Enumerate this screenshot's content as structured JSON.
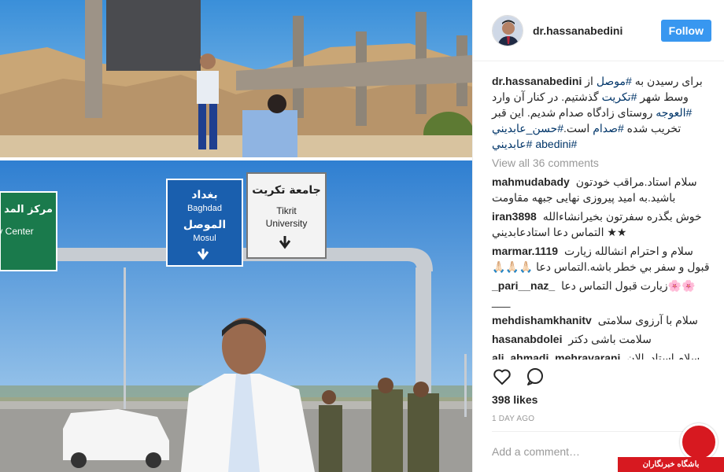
{
  "post": {
    "username": "dr.hassanabedini",
    "follow_label": "Follow",
    "caption": {
      "username": "dr.hassanabedini",
      "segments": [
        {
          "text": "برای رسیدن به ",
          "tag": false
        },
        {
          "text": "#موصل",
          "tag": true
        },
        {
          "text": " از وسط شهر ",
          "tag": false
        },
        {
          "text": "#تکریت",
          "tag": true
        },
        {
          "text": " گذشتیم. در کنار آن وارد ",
          "tag": false
        },
        {
          "text": "#العوجه",
          "tag": true
        },
        {
          "text": " روستای زادگاه صدام شدیم. این قبر تخریب شده ",
          "tag": false
        },
        {
          "text": "#صدام",
          "tag": true
        },
        {
          "text": " است.",
          "tag": false
        },
        {
          "text": "#حسن_عابديني",
          "tag": true
        },
        {
          "text": " ",
          "tag": false
        },
        {
          "text": "#abedini",
          "tag": true
        },
        {
          "text": " ",
          "tag": false
        },
        {
          "text": "#عابديني",
          "tag": true
        }
      ]
    },
    "view_all": "View all 36 comments",
    "comments": [
      {
        "user": "mahmudabady",
        "text": "سلام استاد.مراقب خودتون باشید.به امید پیروزی نهایی جبهه مقاومت"
      },
      {
        "user": "iran3898",
        "text": "خوش بگذره سفرتون بخيرانشاءالله ★★ التماس دعا استادعابديني"
      },
      {
        "user": "marmar.1119",
        "text": "سلام و احترام انشالله زیارت قبول و سفر بي خطر باشه.التماس دعا 🙏🏻🙏🏻🙏🏻"
      },
      {
        "user": "_pari__naz_",
        "text": "🌸🌸زيارت قبول التماس دعا ___"
      },
      {
        "user": "mehdishamkhanitv",
        "text": "سلام با آرزوی سلامتی"
      },
      {
        "user": "hasanabdolei",
        "text": "سلامت باشی دکتر"
      },
      {
        "user": "ali_ahmadi_mehravarani",
        "text": "سلام.استاد. الان کنار قبر تخریب شده هستید یا جاده؟😊!"
      }
    ],
    "likes": "398 likes",
    "time": "1 DAY AGO",
    "add_comment_placeholder": "Add a comment…"
  },
  "photo": {
    "sign_left_arabic": "بغداد",
    "sign_left_latin": "Baghdad",
    "sign_left_arabic2": "الموصل",
    "sign_left_latin2": "Mosul",
    "sign_right_arabic": "جامعة تكريت",
    "sign_right_latin1": "Tikrit",
    "sign_right_latin2": "University",
    "sign_far_arabic": "مركز المد",
    "sign_far_latin": "y Center"
  },
  "watermark": {
    "text": "باشگاه خبرنگاران"
  },
  "icons": [
    "heart-icon",
    "comment-icon"
  ]
}
